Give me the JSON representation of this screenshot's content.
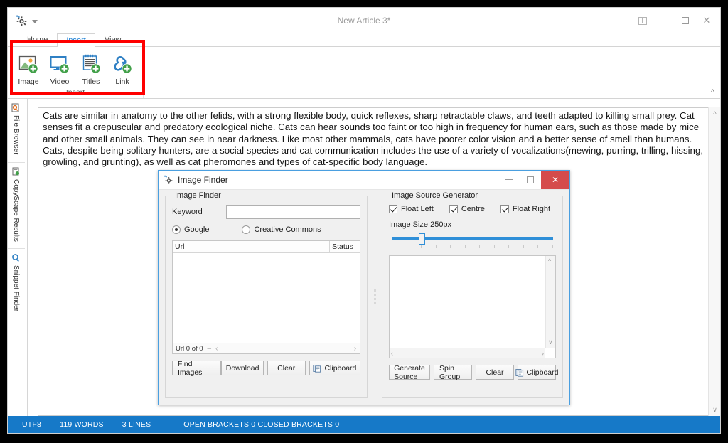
{
  "window": {
    "title": "New Article 3*",
    "qat": {
      "gear_icon": "gear-icon",
      "more_icon": "chevron-down-icon"
    },
    "controls": {
      "ribbon_options": "ribbon-display-options",
      "minimize": "minimize",
      "maximize": "maximize",
      "close": "✕"
    }
  },
  "ribbon": {
    "tabs": [
      {
        "label": "Home",
        "active": false
      },
      {
        "label": "Insert",
        "active": true
      },
      {
        "label": "View",
        "active": false
      }
    ],
    "group": {
      "label": "Insert",
      "buttons": [
        {
          "label": "Image",
          "icon": "image-plus-icon"
        },
        {
          "label": "Video",
          "icon": "video-plus-icon"
        },
        {
          "label": "Titles",
          "icon": "titles-plus-icon"
        },
        {
          "label": "Link",
          "icon": "link-plus-icon"
        }
      ]
    },
    "collapse_icon": "chevron-up-icon",
    "highlight_color": "#ff0000"
  },
  "rail": {
    "items": [
      {
        "label": "File Browser",
        "icon": "file-browser-icon"
      },
      {
        "label": "CopyScape Results",
        "icon": "copyscape-icon"
      },
      {
        "label": "Snippet Finder",
        "icon": "snippet-finder-icon"
      }
    ]
  },
  "editor": {
    "text": "Cats are similar in anatomy to the other felids, with a strong flexible body, quick reflexes, sharp retractable claws, and teeth adapted to killing small prey. Cat senses fit a crepuscular and predatory ecological niche. Cats can hear sounds too faint or too high in frequency for human ears, such as those made by mice and other small animals. They can see in near darkness. Like most other mammals, cats have poorer color vision and a better sense of smell than humans. Cats, despite being solitary hunters, are a social species and cat communication includes the use of a variety of vocalizations(mewing, purring, trilling, hissing, growling, and grunting), as well as cat pheromones and types of cat-specific body language."
  },
  "statusbar": {
    "encoding": "UTF8",
    "words": "119 WORDS",
    "lines": "3 LINES",
    "brackets": "OPEN BRACKETS 0 CLOSED BRACKETS 0",
    "background": "#1679c8"
  },
  "dialog": {
    "title": "Image Finder",
    "icon": "image-finder-icon",
    "controls": {
      "minimize": "minimize",
      "maximize": "maximize",
      "close": "✕"
    },
    "left_panel": {
      "legend": "Image Finder",
      "keyword_label": "Keyword",
      "keyword_value": "",
      "keyword_placeholder": "",
      "radios": [
        {
          "label": "Google",
          "selected": true
        },
        {
          "label": "Creative Commons",
          "selected": false
        }
      ],
      "grid": {
        "columns": [
          "Url",
          "Status"
        ],
        "rows": [],
        "footer": "Url 0 of 0"
      },
      "buttons": [
        {
          "label": "Find Images",
          "icon": null
        },
        {
          "label": "Download",
          "icon": null
        },
        {
          "label": "Clear",
          "icon": null
        },
        {
          "label": "Clipboard",
          "icon": "clipboard-icon"
        }
      ]
    },
    "right_panel": {
      "legend": "Image Source Generator",
      "checkboxes": [
        {
          "label": "Float Left",
          "checked": true
        },
        {
          "label": "Centre",
          "checked": true
        },
        {
          "label": "Float Right",
          "checked": true
        }
      ],
      "size_label": "Image Size 250px",
      "slider_value": 250,
      "buttons": [
        {
          "label": "Generate Source",
          "icon": null
        },
        {
          "label": "Spin Group",
          "icon": null
        },
        {
          "label": "Clear",
          "icon": null
        },
        {
          "label": "Clipboard",
          "icon": "clipboard-icon"
        }
      ],
      "output_text": ""
    }
  }
}
